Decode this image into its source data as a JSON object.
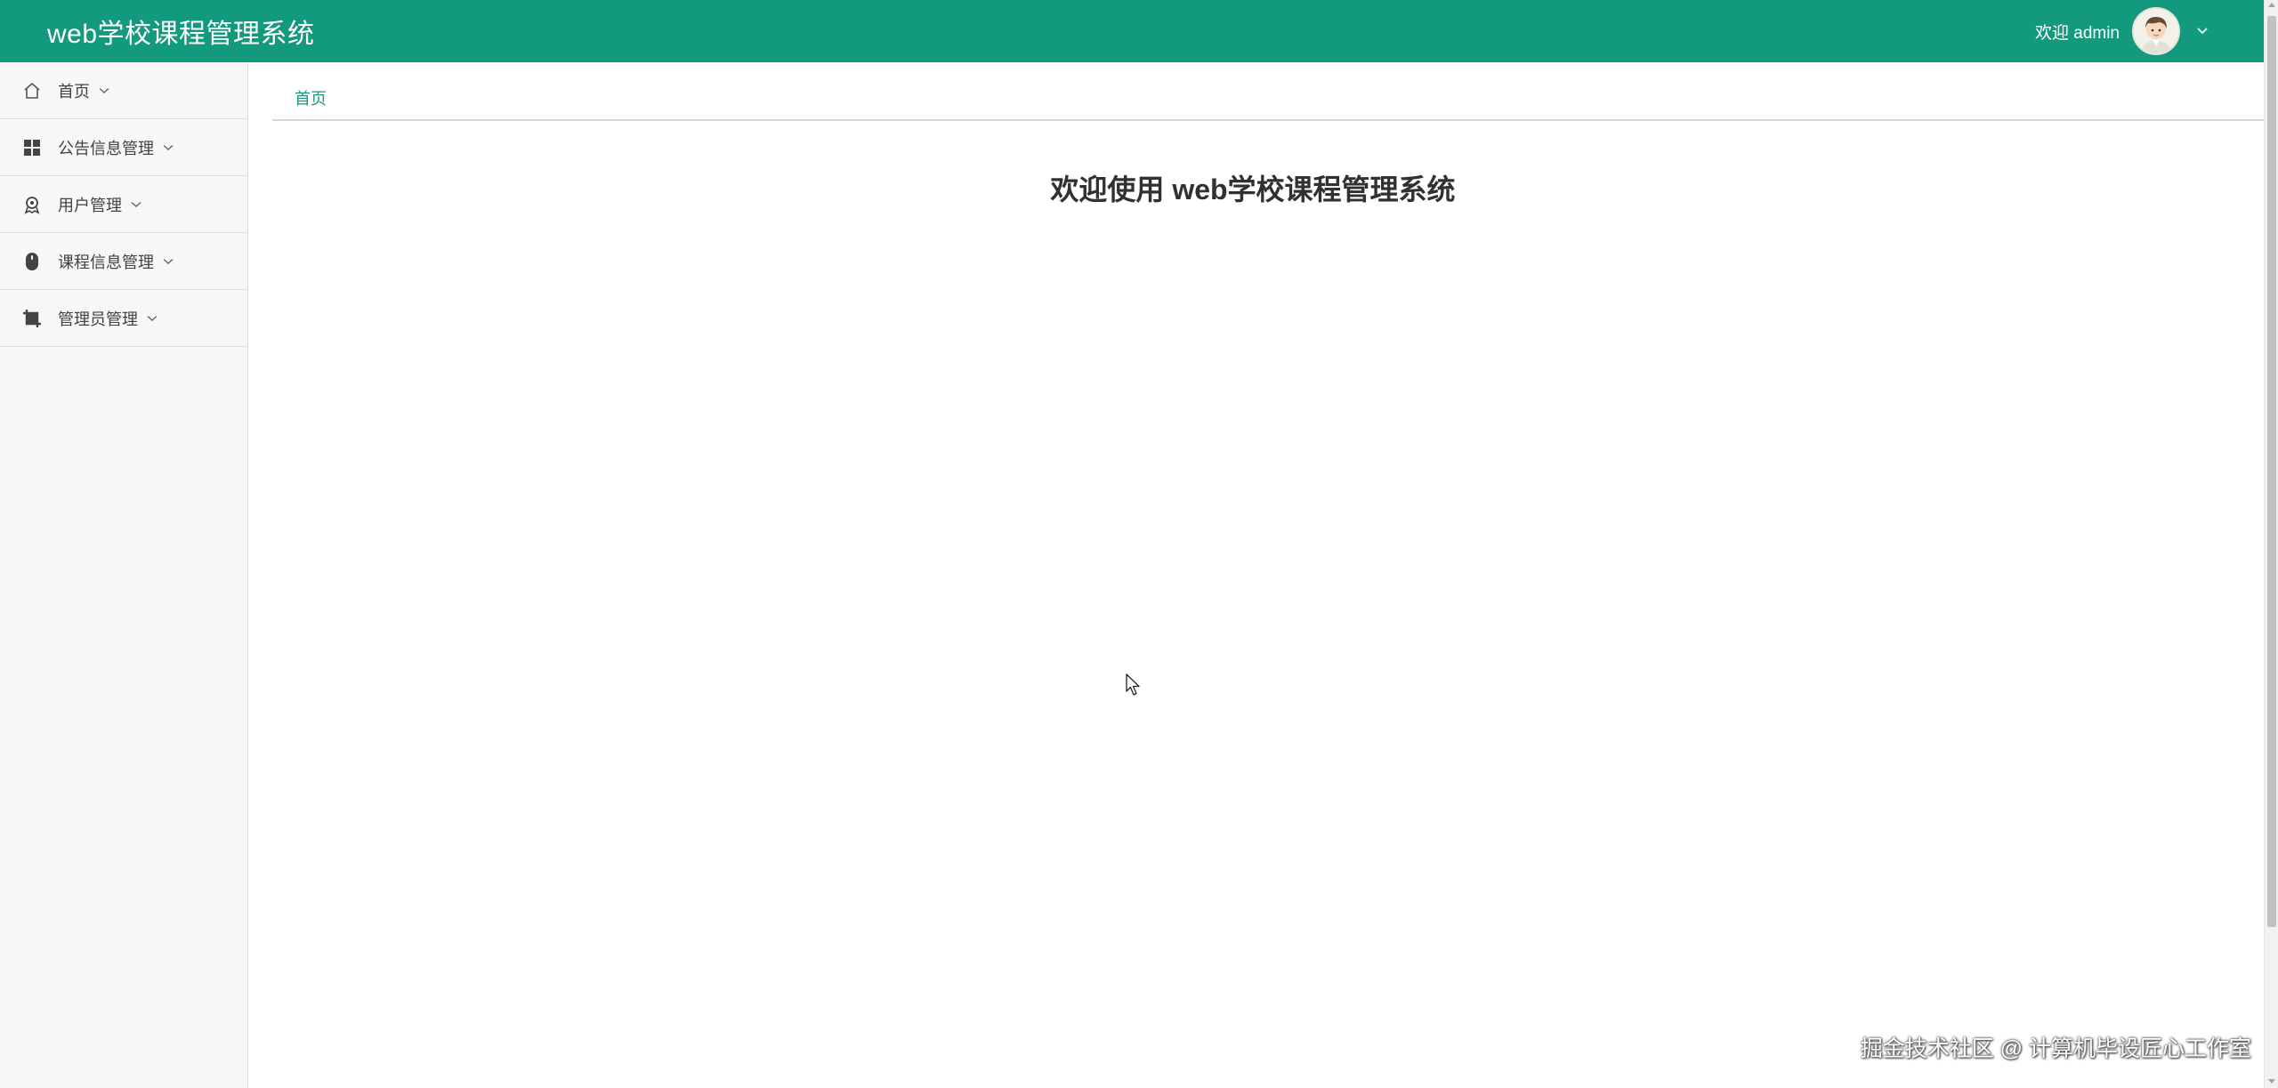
{
  "header": {
    "app_title": "web学校课程管理系统",
    "welcome": "欢迎 admin",
    "avatar_icon": "user-avatar-icon",
    "caret_icon": "chevron-down-icon",
    "brand_color": "#139a7e"
  },
  "sidebar": {
    "items": [
      {
        "label": "首页",
        "icon": "home-icon"
      },
      {
        "label": "公告信息管理",
        "icon": "grid-icon"
      },
      {
        "label": "用户管理",
        "icon": "user-badge-icon"
      },
      {
        "label": "课程信息管理",
        "icon": "mouse-icon"
      },
      {
        "label": "管理员管理",
        "icon": "crop-icon"
      }
    ]
  },
  "breadcrumb": {
    "current": "首页"
  },
  "main": {
    "heading": "欢迎使用 web学校课程管理系统"
  },
  "watermark": {
    "text": "掘金技术社区 @ 计算机毕设匠心工作室"
  }
}
